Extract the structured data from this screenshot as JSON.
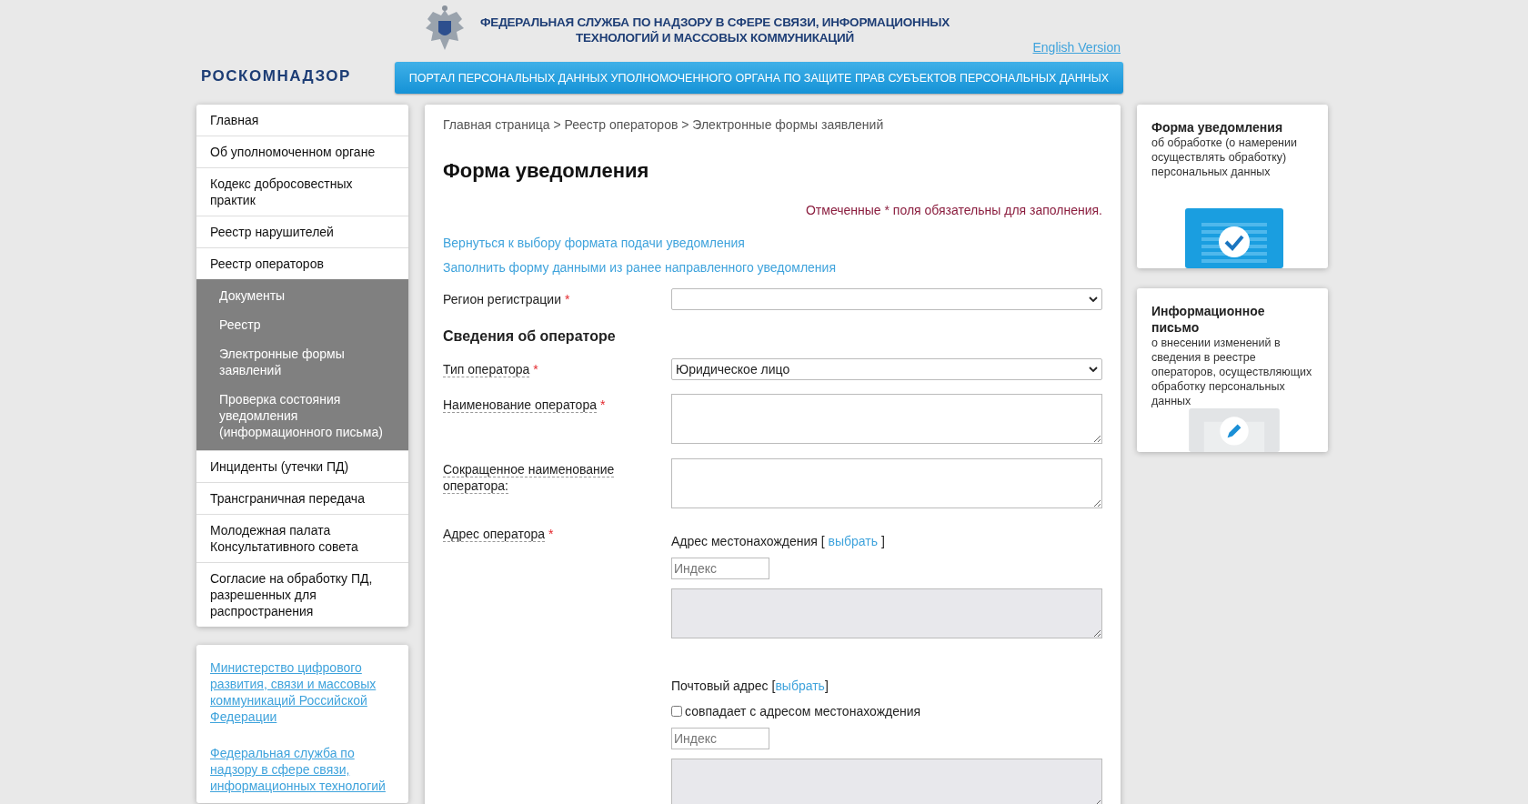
{
  "header": {
    "title_lines": [
      "ФЕДЕРАЛЬНАЯ СЛУЖБА ПО НАДЗОРУ В СФЕРЕ СВЯЗИ, ИНФОРМАЦИОННЫХ",
      "ТЕХНОЛОГИЙ И МАССОВЫХ КОММУНИКАЦИЙ"
    ],
    "language_link": "English Version",
    "logo": "РОСКОМНАДЗОР",
    "banner": "ПОРТАЛ ПЕРСОНАЛЬНЫХ ДАННЫХ УПОЛНОМОЧЕННОГО ОРГАНА ПО ЗАЩИТЕ ПРАВ СУБЪЕКТОВ ПЕРСОНАЛЬНЫХ ДАННЫХ"
  },
  "sidebar": {
    "items": [
      {
        "label": "Главная"
      },
      {
        "label": "Об уполномоченном органе"
      },
      {
        "label": "Кодекс добросовестных практик"
      },
      {
        "label": "Реестр нарушителей"
      },
      {
        "label": "Реестр операторов",
        "children": [
          {
            "label": "Документы"
          },
          {
            "label": "Реестр"
          },
          {
            "label": "Электронные формы заявлений"
          },
          {
            "label": "Проверка состояния уведомления (информационного письма)"
          }
        ]
      },
      {
        "label": "Инциденты (утечки ПД)"
      },
      {
        "label": "Трансграничная передача"
      },
      {
        "label": "Молодежная палата Консультативного совета"
      },
      {
        "label": "Согласие на обработку ПД, разрешенных для распространения"
      }
    ],
    "links": [
      "Министерство цифрового развития, связи и массовых коммуникаций Российской Федерации",
      "Федеральная служба по надзору в сфере связи, информационных технологий"
    ]
  },
  "form": {
    "breadcrumb": [
      "Главная страница",
      "Реестр операторов",
      "Электронные формы заявлений"
    ],
    "breadcrumb_separator": ">",
    "title": "Форма уведомления",
    "required_note": "Отмеченные * поля обязательны для заполнения.",
    "required_mark": "*",
    "links": [
      "Вернуться к выбору формата подачи уведомления",
      "Заполнить форму данными из ранее направленного уведомления"
    ],
    "fields": [
      {
        "kind": "select",
        "label": "Регион регистрации",
        "required": true,
        "has_tooltip": false
      },
      {
        "kind": "heading",
        "label": "Сведения об операторе"
      },
      {
        "kind": "select",
        "label": "Тип оператора",
        "required": true,
        "has_tooltip": true,
        "value": "Юридическое лицо"
      },
      {
        "kind": "textarea",
        "label": "Наименование оператора",
        "required": true,
        "has_tooltip": true
      },
      {
        "kind": "textarea",
        "label": "Сокращенное наименование оператора:",
        "required": false,
        "has_tooltip": true
      },
      {
        "kind": "address",
        "label": "Адрес оператора",
        "required": true,
        "has_tooltip": true,
        "blocks": [
          {
            "title": "Адрес местонахождения",
            "bracket_open": "[ ",
            "link": "выбрать",
            "bracket_close": " ]",
            "placeholder": "Индекс"
          },
          {
            "title": "Почтовый адрес",
            "bracket_open": "[",
            "link": "выбрать",
            "bracket_close": "]",
            "checkbox": {
              "label": "совпадает с адресом местонахождения",
              "checked": false
            },
            "placeholder": "Индекс"
          }
        ]
      }
    ]
  },
  "promo_cards": [
    {
      "kind": "check",
      "title": "Форма уведомления",
      "text": "об обработке (о намерении осуществлять обработку) персональных данных"
    },
    {
      "kind": "edit",
      "title": "Информационное письмо",
      "text": "о внесении изменений в сведения в реестре операторов, осуществляющих обработку персональных данных"
    }
  ]
}
